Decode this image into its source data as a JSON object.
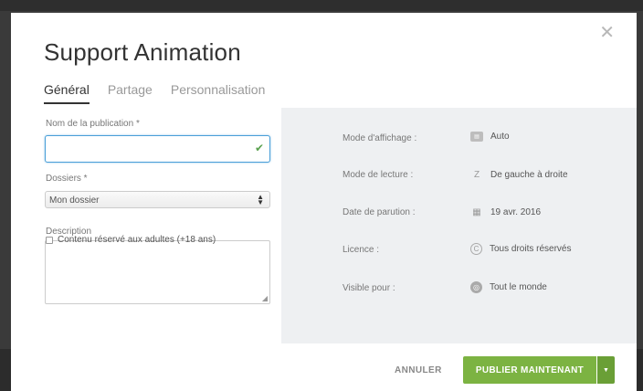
{
  "dialog": {
    "title": "Support Animation",
    "close_icon": "close-icon"
  },
  "tabs": [
    {
      "label": "Général",
      "active": true
    },
    {
      "label": "Partage",
      "active": false
    },
    {
      "label": "Personnalisation",
      "active": false
    }
  ],
  "form": {
    "name_label": "Nom de la publication *",
    "name_value": "",
    "folders_label": "Dossiers *",
    "folder_selected": "Mon dossier",
    "description_label": "Description",
    "description_value": "",
    "adult_checkbox_label": "Contenu réservé aux adultes (+18 ans)",
    "adult_checked": false
  },
  "properties": [
    {
      "label": "Mode d'affichage :",
      "value": "Auto",
      "icon": "display-mode-icon"
    },
    {
      "label": "Mode de lecture :",
      "value": "De gauche à droite",
      "icon": "reading-direction-icon"
    },
    {
      "label": "Date de parution :",
      "value": "19 avr. 2016",
      "icon": "calendar-icon"
    },
    {
      "label": "Licence :",
      "value": "Tous droits réservés",
      "icon": "copyright-icon"
    },
    {
      "label": "Visible pour :",
      "value": "Tout le monde",
      "icon": "globe-icon"
    }
  ],
  "footer": {
    "cancel_label": "ANNULER",
    "publish_label": "PUBLIER MAINTENANT",
    "dropdown_icon": "caret-down-icon"
  },
  "colors": {
    "accent_green": "#7cb342",
    "focus_blue": "#4a9fd8",
    "panel_gray": "#eef0f2"
  }
}
